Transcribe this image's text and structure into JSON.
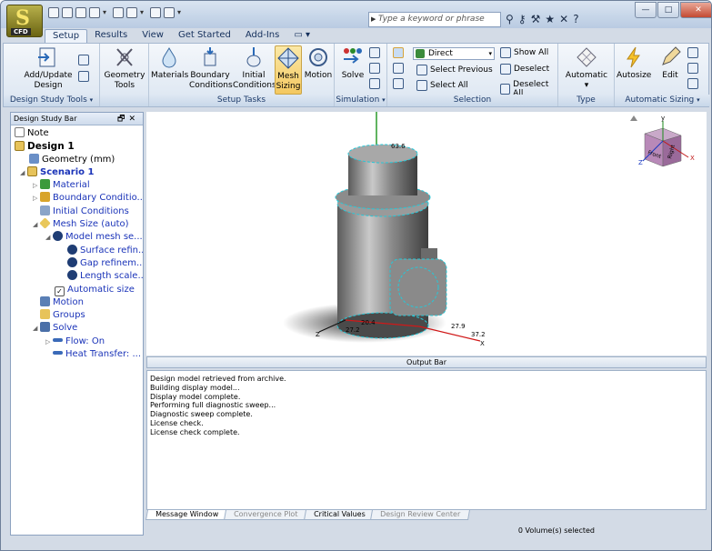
{
  "app": {
    "badge_label": "CFD"
  },
  "search": {
    "placeholder": "Type a keyword or phrase"
  },
  "tabs": [
    {
      "label": "Setup",
      "active": true
    },
    {
      "label": "Results"
    },
    {
      "label": "View"
    },
    {
      "label": "Get Started"
    },
    {
      "label": "Add-Ins"
    }
  ],
  "ribbon": {
    "groups": [
      {
        "label": "Design Study Tools"
      },
      {
        "label": "Setup Tasks"
      },
      {
        "label": "Simulation"
      },
      {
        "label": "Selection"
      },
      {
        "label": "Type"
      },
      {
        "label": "Automatic Sizing"
      }
    ],
    "add_update_label": "Add/Update",
    "add_update_label2": "Design",
    "geometry_tools_label": "Geometry",
    "geometry_tools_label2": "Tools",
    "materials_label": "Materials",
    "boundary_label": "Boundary",
    "boundary_label2": "Conditions",
    "initial_label": "Initial",
    "initial_label2": "Conditions",
    "mesh_label": "Mesh",
    "mesh_label2": "Sizing",
    "motion_label": "Motion",
    "solve_label": "Solve",
    "selection_mode": "Direct",
    "select_previous": "Select Previous",
    "select_all": "Select All",
    "show_all": "Show All",
    "deselect": "Deselect",
    "deselect_all": "Deselect All",
    "automatic_label": "Automatic",
    "autosize_label": "Autosize",
    "edit_label": "Edit"
  },
  "design_study_bar": {
    "title": "Design Study Bar",
    "items": [
      {
        "label": "Note"
      },
      {
        "label": "Design 1"
      },
      {
        "label": "Geometry (mm)"
      },
      {
        "label": "Scenario 1"
      },
      {
        "label": "Material"
      },
      {
        "label": "Boundary Conditio..."
      },
      {
        "label": "Initial Conditions"
      },
      {
        "label": "Mesh Size (auto)"
      },
      {
        "label": "Model mesh se..."
      },
      {
        "label": "Surface refin..."
      },
      {
        "label": "Gap refinem..."
      },
      {
        "label": "Length scale..."
      },
      {
        "label": "Automatic size"
      },
      {
        "label": "Motion"
      },
      {
        "label": "Groups"
      },
      {
        "label": "Solve"
      },
      {
        "label": "Flow: On"
      },
      {
        "label": "Heat Transfer: ..."
      }
    ]
  },
  "viewport": {
    "dim_top": "63.6",
    "dim_left_a": "20.4",
    "dim_left_b": "27.2",
    "dim_right_a": "27.9",
    "dim_right_b": "37.2",
    "axis_z": "Z",
    "axis_x": "X",
    "cube_front": "Front",
    "cube_right": "Right",
    "cube_y": "y",
    "cube_x": "X",
    "cube_z": "Z"
  },
  "output_bar": {
    "title": "Output Bar"
  },
  "messages": [
    "Design model retrieved from archive.",
    "Building display model...",
    "Display model complete.",
    "Performing full diagnostic sweep...",
    "Diagnostic sweep complete.",
    "License check.",
    "License check complete."
  ],
  "bottom_tabs": [
    {
      "label": "Message Window",
      "active": true
    },
    {
      "label": "Convergence Plot"
    },
    {
      "label": "Critical Values"
    },
    {
      "label": "Design Review Center"
    }
  ],
  "status": {
    "text": "0 Volume(s) selected"
  }
}
